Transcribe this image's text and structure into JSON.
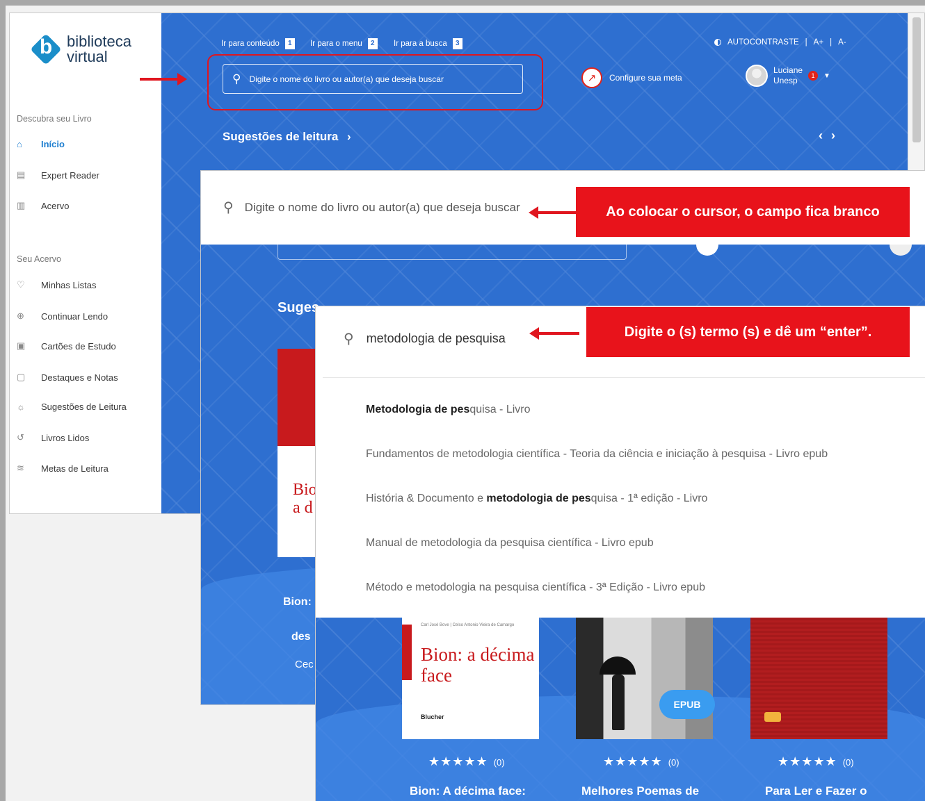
{
  "logo": {
    "line1": "biblioteca",
    "line2": "virtual",
    "mark": "b"
  },
  "sidebar": {
    "section1": "Descubra seu Livro",
    "items1": [
      {
        "label": "Início",
        "icon": "home-icon",
        "glyph": "⌂"
      },
      {
        "label": "Expert Reader",
        "icon": "reader-icon",
        "glyph": "▤"
      },
      {
        "label": "Acervo",
        "icon": "books-icon",
        "glyph": "▥"
      }
    ],
    "section2": "Seu Acervo",
    "items2": [
      {
        "label": "Minhas Listas",
        "icon": "heart-icon",
        "glyph": "♡"
      },
      {
        "label": "Continuar Lendo",
        "icon": "bookmark-icon",
        "glyph": "⊕"
      },
      {
        "label": "Cartões de Estudo",
        "icon": "cards-icon",
        "glyph": "▣"
      },
      {
        "label": "Destaques e Notas",
        "icon": "note-icon",
        "glyph": "▢"
      },
      {
        "label": "Sugestões de Leitura",
        "icon": "lightbulb-icon",
        "glyph": "☼"
      },
      {
        "label": "Livros Lidos",
        "icon": "history-icon",
        "glyph": "↺"
      },
      {
        "label": "Metas de Leitura",
        "icon": "goals-icon",
        "glyph": "≋"
      }
    ]
  },
  "header": {
    "skip_content": "Ir para conteúdo",
    "skip_content_key": "1",
    "skip_menu": "Ir para o menu",
    "skip_menu_key": "2",
    "skip_search": "Ir para a busca",
    "skip_search_key": "3",
    "contrast": "AUTOCONTRASTE",
    "font_plus": "A+",
    "font_minus": "A-",
    "search_placeholder": "Digite o nome do livro ou autor(a) que deseja buscar",
    "meta_label": "Configure sua meta",
    "user_name": "Luciane",
    "user_org": "Unesp",
    "badge": "1",
    "suggestions_title": "Sugestões de leitura",
    "suggestions_arrow": "›",
    "nav_prev": "‹",
    "nav_next": "›"
  },
  "shot2": {
    "search_placeholder": "Digite o nome do livro ou autor(a) que deseja buscar",
    "callout": "Ao colocar o cursor, o campo fica branco",
    "faded_heading": "Suges",
    "book_cover": "Bio a d",
    "side_title": "Bion:",
    "side_desc": "des",
    "side_author": "Cec Ce"
  },
  "shot3": {
    "query": "metodologia de pesquisa",
    "callout": "Digite o (s)  termo (s) e dê um “enter”.",
    "suggestions": [
      {
        "pre": "",
        "bold": "Metodologia de pes",
        "post": "quisa - Livro"
      },
      {
        "pre": "Fundamentos de metodologia científica - Teoria da ciência e iniciação à pesquisa - Livro epub",
        "bold": "",
        "post": ""
      },
      {
        "pre": "História & Documento e ",
        "bold": "metodologia de pes",
        "post": "quisa - 1ª edição - Livro"
      },
      {
        "pre": "Manual de metodologia da pesquisa científica - Livro epub",
        "bold": "",
        "post": ""
      },
      {
        "pre": "Método e metodologia na pesquisa científica - 3ª Edição - Livro epub",
        "bold": "",
        "post": ""
      }
    ],
    "books": [
      {
        "title": "Bion: A décima face:",
        "rating_count": "(0)",
        "stars": "★★★★★"
      },
      {
        "title": "Melhores Poemas de",
        "rating_count": "(0)",
        "stars": "★★★★★"
      },
      {
        "title": "Para Ler e Fazer o",
        "rating_count": "(0)",
        "stars": "★★★★★"
      }
    ],
    "cover1_title": "Bion: a décima face",
    "cover1_publisher": "Blucher",
    "cover1_authors": "Carl José Bove | Celso Antonio Vieira de Camargo",
    "epub_badge": "EPUB"
  },
  "colors": {
    "brand_blue": "#2e6fd0",
    "callout_red": "#e8131b",
    "accent_link": "#1f7fd0"
  }
}
